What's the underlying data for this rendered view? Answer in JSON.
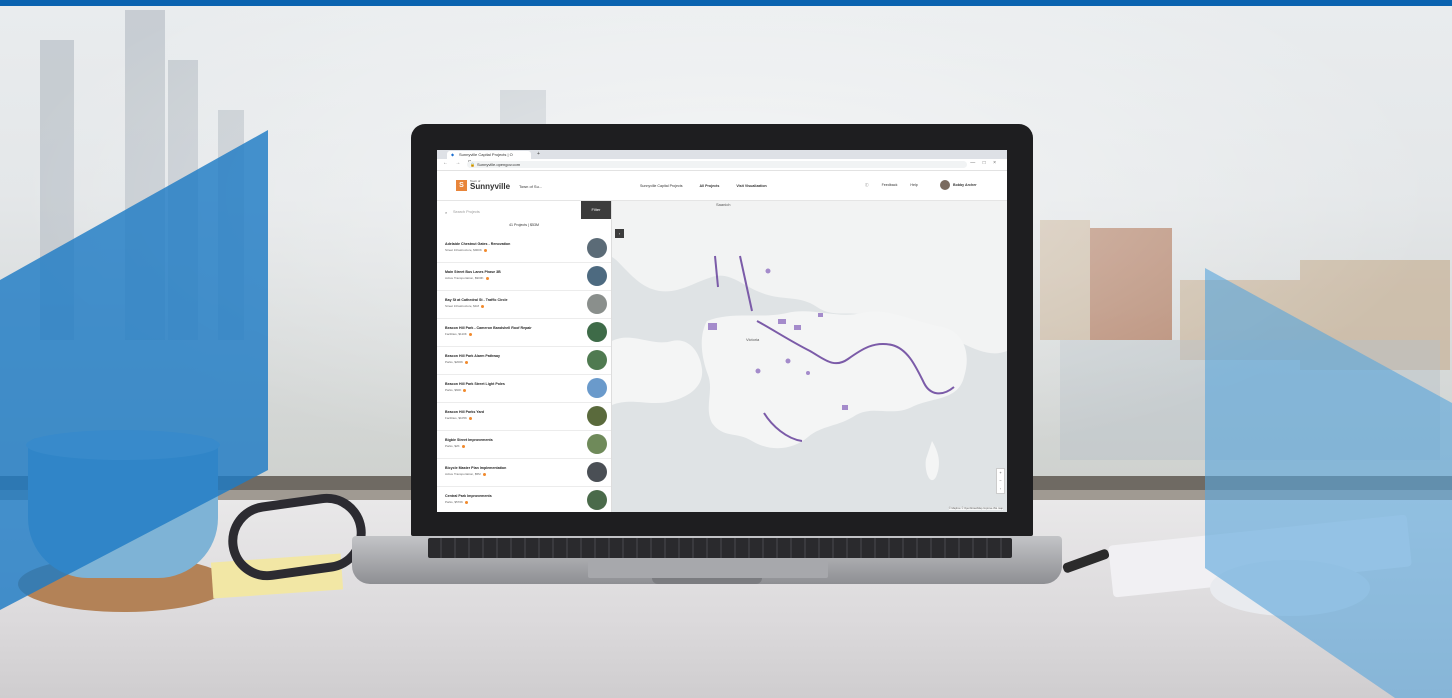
{
  "browser": {
    "tab_title": "Sunnyville Capital Projects | O",
    "tab_close": "×",
    "new_tab": "+",
    "nav_icons": "← → C",
    "lock_icon": "🔒",
    "url": "Sunnyville.opengov.com",
    "window_icons": "— □ ×"
  },
  "app": {
    "logo_mark": "S",
    "logo_small": "Town of",
    "logo_name": "Sunnyville",
    "org_name": "Town of Su...",
    "nav": [
      "Sunnyville Capital Projects",
      "All Projects",
      "Visit Visualization"
    ],
    "header_right": [
      "Feedback",
      "Help"
    ],
    "user_name": "Bobby Archer"
  },
  "sidebar": {
    "search_placeholder": "Search Projects",
    "filter_label": "Filter",
    "stats": "41 Projects  |  $53M",
    "items": [
      {
        "title": "Adelaide Chestnut Gates - Renovation",
        "sub": "Street Infrastructure, $900K"
      },
      {
        "title": "Main Street Bus Lanes Phase 3B",
        "sub": "Active Transportation, $900K"
      },
      {
        "title": "Bay St at Cathedral St - Traffic Circle",
        "sub": "Street Infrastructure, $1M"
      },
      {
        "title": "Beacon Hill Park - Cameron Bandshell Roof Repair",
        "sub": "Facilities, $110K"
      },
      {
        "title": "Beacon Hill Park Alarm Pathway",
        "sub": "Parks, $200K"
      },
      {
        "title": "Beacon Hill Park Street Light Poles",
        "sub": "Parks, $60K"
      },
      {
        "title": "Beacon Hill Parks Yard",
        "sub": "Facilities, $105K"
      },
      {
        "title": "Bigbie Street Improvements",
        "sub": "Parks, $2K"
      },
      {
        "title": "Bicycle Master Plan Implementation",
        "sub": "Active Transportation, $5M"
      },
      {
        "title": "Central Park Improvements",
        "sub": "Parks, $570K"
      }
    ]
  },
  "map": {
    "label_top": "Saanich",
    "label_city": "Victoria",
    "zoom_in": "+",
    "zoom_out": "−",
    "attribution": "© Mapbox © OpenStreetMap  Improve this map"
  },
  "colors": {
    "accent": "#0a63b0",
    "route": "#7b5ba8",
    "status_dot": "#f18a2d"
  }
}
